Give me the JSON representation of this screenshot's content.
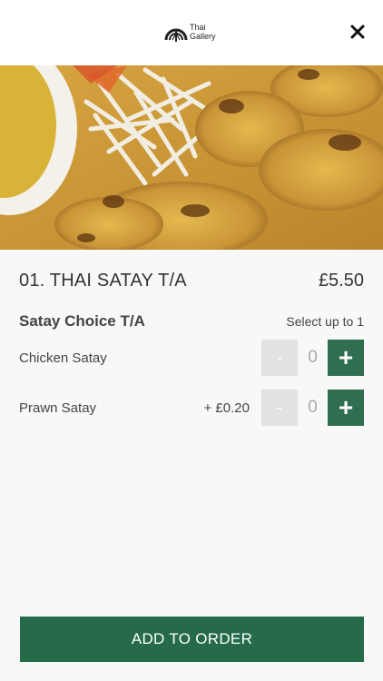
{
  "header": {
    "logo_line1": "Thai",
    "logo_line2": "Gallery",
    "close_icon": "close-icon"
  },
  "item": {
    "title": "01. THAI SATAY T/A",
    "price": "£5.50"
  },
  "option_group": {
    "title": "Satay Choice T/A",
    "limit_text": "Select up to 1",
    "options": [
      {
        "name": "Chicken Satay",
        "extra": "",
        "qty": "0",
        "minus": "-",
        "plus": "+"
      },
      {
        "name": "Prawn Satay",
        "extra": "+ £0.20",
        "qty": "0",
        "minus": "-",
        "plus": "+"
      }
    ]
  },
  "footer": {
    "add_label": "ADD TO ORDER"
  },
  "colors": {
    "accent": "#256b4a",
    "plus_button": "#2f6e4f",
    "minus_button": "#e2e2e2",
    "background": "#f8f8f8"
  }
}
